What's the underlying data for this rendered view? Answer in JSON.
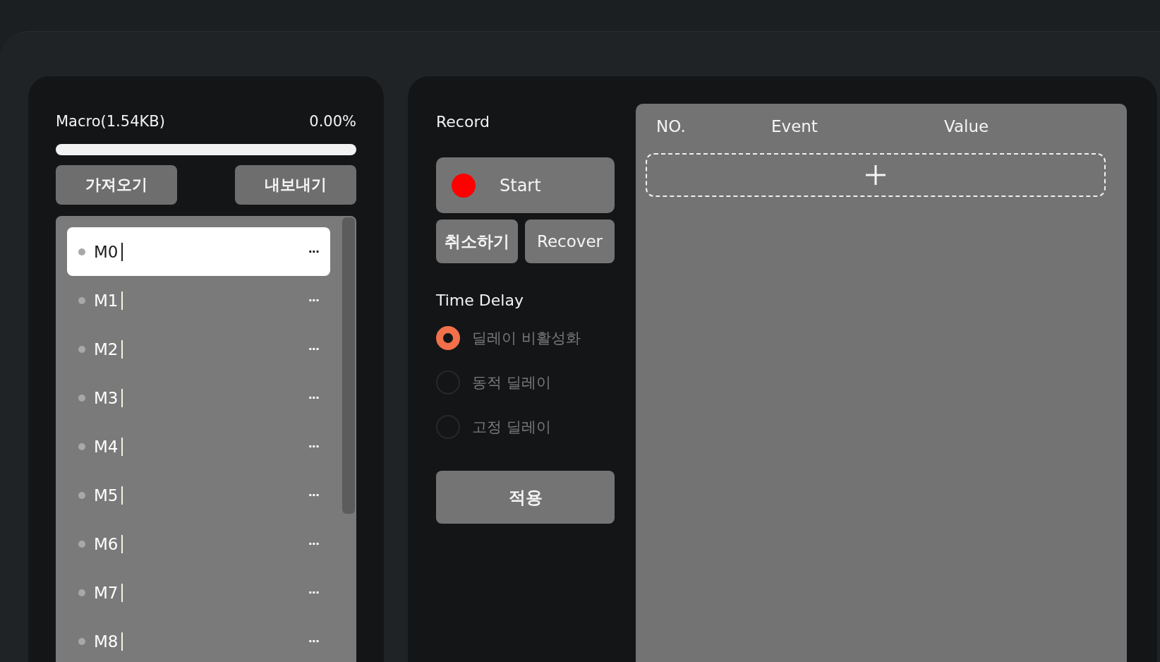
{
  "macro_panel": {
    "title": "Macro(1.54KB)",
    "usage": "0.00%",
    "buttons": [
      {
        "label": "가져오기"
      },
      {
        "label": "내보내기"
      }
    ],
    "macros": [
      {
        "name": "M0",
        "menu": "···",
        "selected": true
      },
      {
        "name": "M1",
        "menu": "···",
        "selected": false
      },
      {
        "name": "M2",
        "menu": "···",
        "selected": false
      },
      {
        "name": "M3",
        "menu": "···",
        "selected": false
      },
      {
        "name": "M4",
        "menu": "···",
        "selected": false
      },
      {
        "name": "M5",
        "menu": "···",
        "selected": false
      },
      {
        "name": "M6",
        "menu": "···",
        "selected": false
      },
      {
        "name": "M7",
        "menu": "···",
        "selected": false
      },
      {
        "name": "M8",
        "menu": "···",
        "selected": false
      }
    ]
  },
  "record": {
    "title": "Record",
    "start_button": "Start",
    "cancel_button": "취소하기",
    "recover_button": "Recover",
    "time_delay": {
      "title": "Time Delay",
      "options": [
        {
          "label": "딜레이 비활성화",
          "selected": true
        },
        {
          "label": "동적 딜레이",
          "selected": false
        },
        {
          "label": "고정 딜레이",
          "selected": false
        }
      ]
    },
    "apply_button": "적용"
  },
  "events_table": {
    "columns": [
      "NO.",
      "Event",
      "Value"
    ]
  }
}
